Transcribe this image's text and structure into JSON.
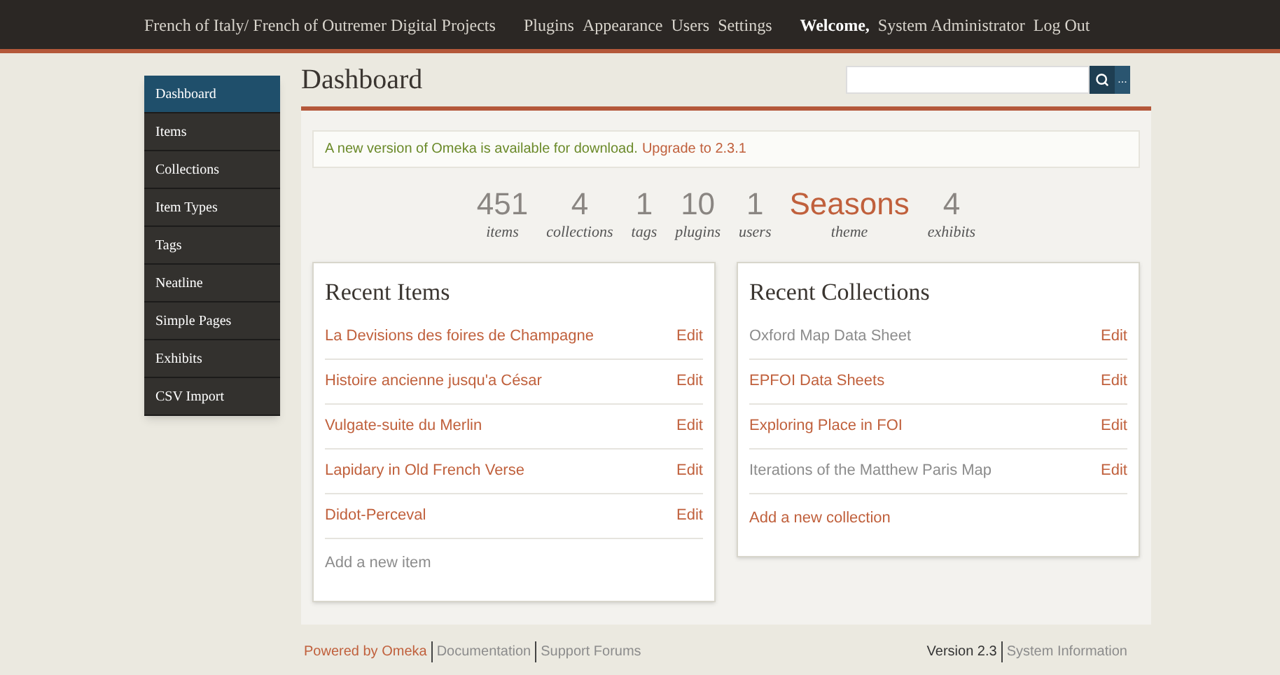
{
  "top_bar": {
    "site_title": "French of Italy/ French of Outremer Digital Projects",
    "nav": [
      "Plugins",
      "Appearance",
      "Users",
      "Settings"
    ],
    "welcome": "Welcome,",
    "user": "System Administrator",
    "logout": "Log Out"
  },
  "sidebar": {
    "items": [
      {
        "label": "Dashboard",
        "selected": true
      },
      {
        "label": "Items",
        "selected": false
      },
      {
        "label": "Collections",
        "selected": false
      },
      {
        "label": "Item Types",
        "selected": false
      },
      {
        "label": "Tags",
        "selected": false
      },
      {
        "label": "Neatline",
        "selected": false
      },
      {
        "label": "Simple Pages",
        "selected": false
      },
      {
        "label": "Exhibits",
        "selected": false
      },
      {
        "label": "CSV Import",
        "selected": false
      }
    ]
  },
  "page_title": "Dashboard",
  "search": {
    "more_label": "..."
  },
  "alert": {
    "message": "A new version of Omeka is available for download.",
    "link": "Upgrade to 2.3.1"
  },
  "stats": [
    {
      "value": "451",
      "label": "items",
      "kind": "number"
    },
    {
      "value": "4",
      "label": "collections",
      "kind": "number"
    },
    {
      "value": "1",
      "label": "tags",
      "kind": "number"
    },
    {
      "value": "10",
      "label": "plugins",
      "kind": "number"
    },
    {
      "value": "1",
      "label": "users",
      "kind": "number"
    },
    {
      "value": "Seasons",
      "label": "theme",
      "kind": "link"
    },
    {
      "value": "4",
      "label": "exhibits",
      "kind": "number"
    }
  ],
  "recent_items": {
    "title": "Recent Items",
    "rows": [
      {
        "title": "La Devisions des foires de Champagne",
        "visited": false,
        "action": "Edit"
      },
      {
        "title": "Histoire ancienne jusqu'a César",
        "visited": false,
        "action": "Edit"
      },
      {
        "title": "Vulgate-suite du Merlin",
        "visited": false,
        "action": "Edit"
      },
      {
        "title": "Lapidary in Old French Verse",
        "visited": false,
        "action": "Edit"
      },
      {
        "title": "Didot-Perceval",
        "visited": false,
        "action": "Edit"
      }
    ],
    "add": {
      "label": "Add a new item",
      "visited": true
    }
  },
  "recent_collections": {
    "title": "Recent Collections",
    "rows": [
      {
        "title": "Oxford Map Data Sheet",
        "visited": true,
        "action": "Edit"
      },
      {
        "title": "EPFOI Data Sheets",
        "visited": false,
        "action": "Edit"
      },
      {
        "title": "Exploring Place in FOI",
        "visited": false,
        "action": "Edit"
      },
      {
        "title": "Iterations of the Matthew Paris Map",
        "visited": true,
        "action": "Edit"
      }
    ],
    "add": {
      "label": "Add a new collection",
      "visited": false
    }
  },
  "footer": {
    "left": [
      {
        "label": "Powered by Omeka",
        "visited": false
      },
      {
        "label": "Documentation",
        "visited": true
      },
      {
        "label": "Support Forums",
        "visited": true
      }
    ],
    "version": "Version 2.3",
    "right_link": {
      "label": "System Information",
      "visited": true
    }
  }
}
